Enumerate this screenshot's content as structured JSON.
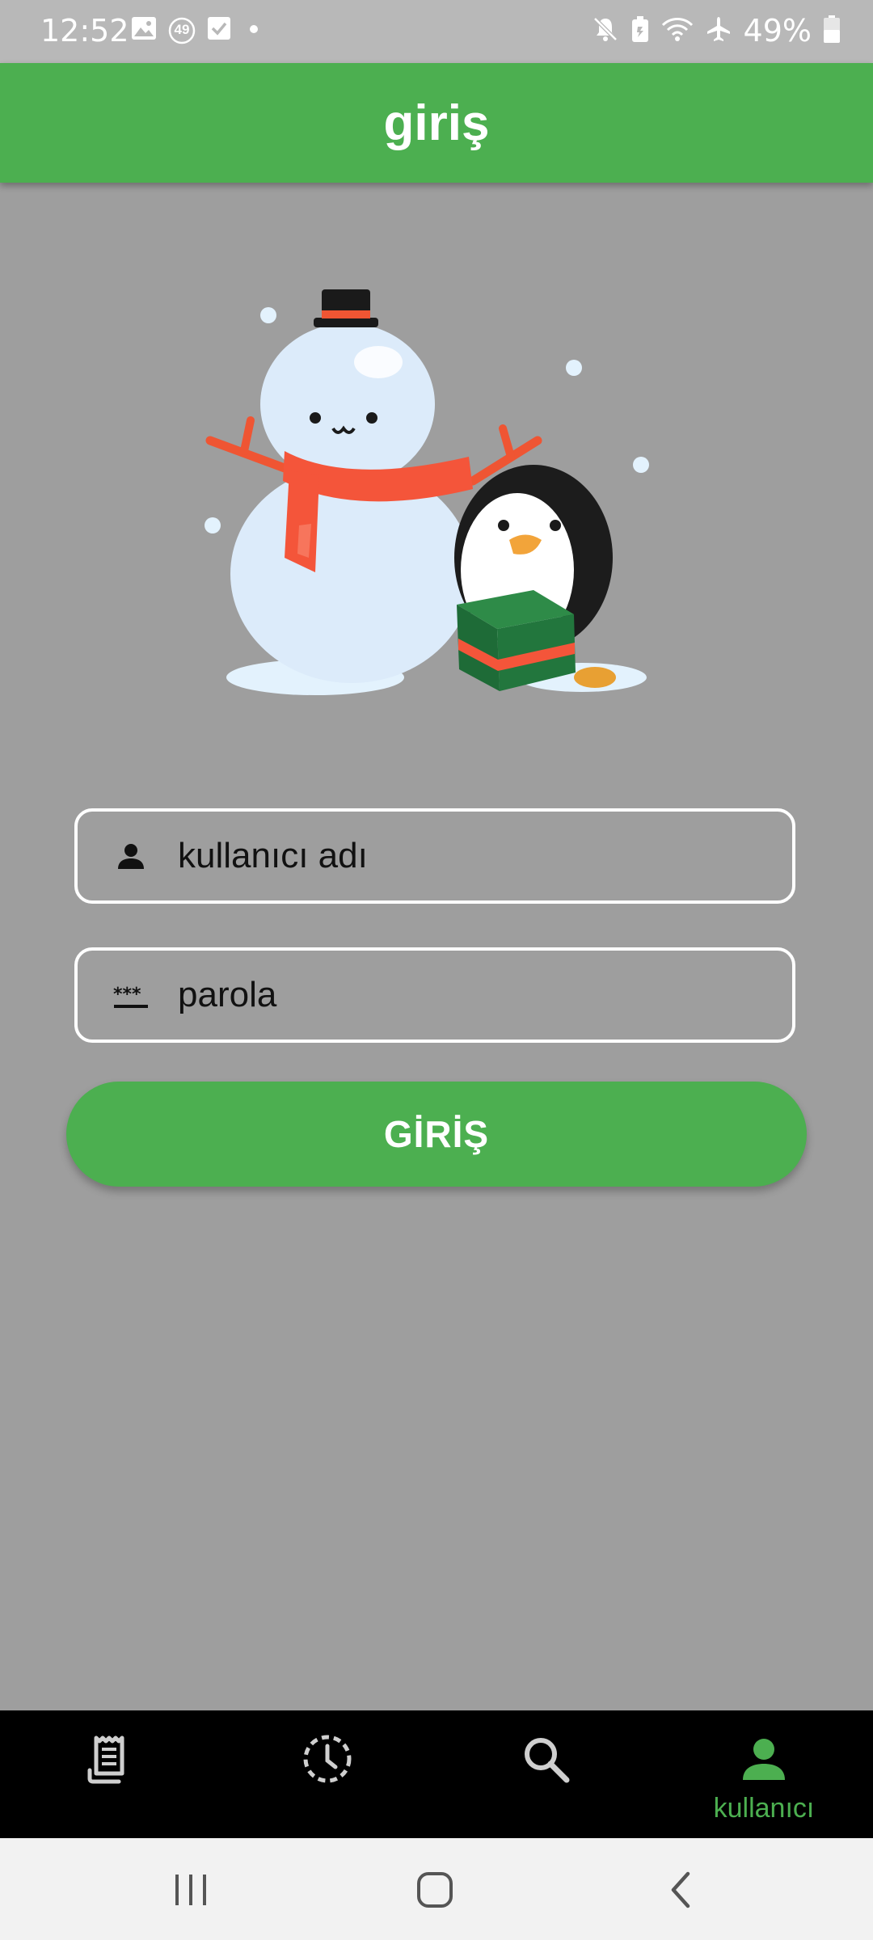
{
  "status_bar": {
    "time": "12:52",
    "notification_count": "49",
    "battery_percent": "49%",
    "left_icons": [
      "image-icon",
      "badge-icon",
      "check-icon",
      "dot-icon"
    ],
    "right_icons": [
      "mute-icon",
      "battery-saver-icon",
      "wifi-off-icon",
      "airplane-icon",
      "battery-icon"
    ]
  },
  "app_bar": {
    "title": "giriş"
  },
  "form": {
    "username": {
      "placeholder": "kullanıcı adı",
      "value": "",
      "icon": "person-icon"
    },
    "password": {
      "placeholder": "parola",
      "value": "",
      "icon": "password-icon"
    },
    "login_label": "GİRİŞ"
  },
  "bottom_nav": {
    "items": [
      {
        "icon": "receipt-icon",
        "label": "",
        "active": false
      },
      {
        "icon": "history-icon",
        "label": "",
        "active": false
      },
      {
        "icon": "search-icon",
        "label": "",
        "active": false
      },
      {
        "icon": "person-icon",
        "label": "kullanıcı",
        "active": true
      }
    ]
  },
  "colors": {
    "accent": "#4caf50",
    "background": "#9e9e9e",
    "nav_background": "#000000",
    "nav_inactive_icon": "#cfcfcf"
  }
}
